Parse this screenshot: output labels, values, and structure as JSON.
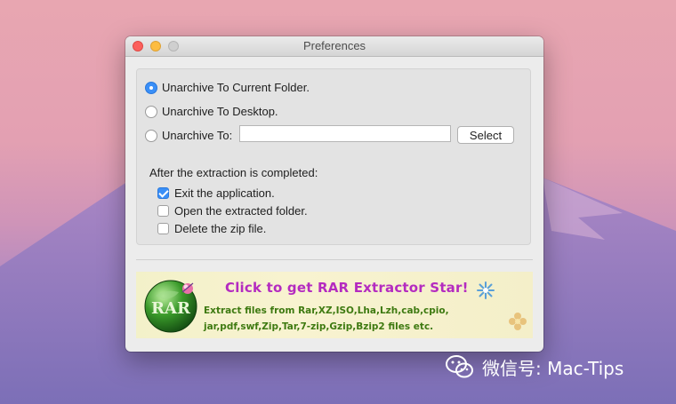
{
  "window": {
    "title": "Preferences"
  },
  "options": {
    "radio_current": "Unarchive To Current Folder.",
    "radio_desktop": "Unarchive To Desktop.",
    "radio_to": "Unarchive To:",
    "path_value": "",
    "select_button": "Select",
    "selected_radio": "radio_current"
  },
  "after": {
    "heading": "After the extraction is completed:",
    "exit_app": "Exit the application.",
    "exit_app_checked": true,
    "open_folder": "Open the extracted folder.",
    "open_folder_checked": false,
    "delete_zip": "Delete the zip file.",
    "delete_zip_checked": false
  },
  "banner": {
    "logo_text": "RAR",
    "title": "Click to get RAR Extractor Star!",
    "line1": "Extract files from Rar,XZ,ISO,Lha,Lzh,cab,cpio,",
    "line2": "jar,pdf,swf,Zip,Tar,7-zip,Gzip,Bzip2 files etc."
  },
  "watermark": {
    "text": "微信号: Mac-Tips"
  },
  "colors": {
    "accent": "#3a8ff7",
    "banner_title": "#b42bc0",
    "banner_text": "#3e7a11"
  }
}
